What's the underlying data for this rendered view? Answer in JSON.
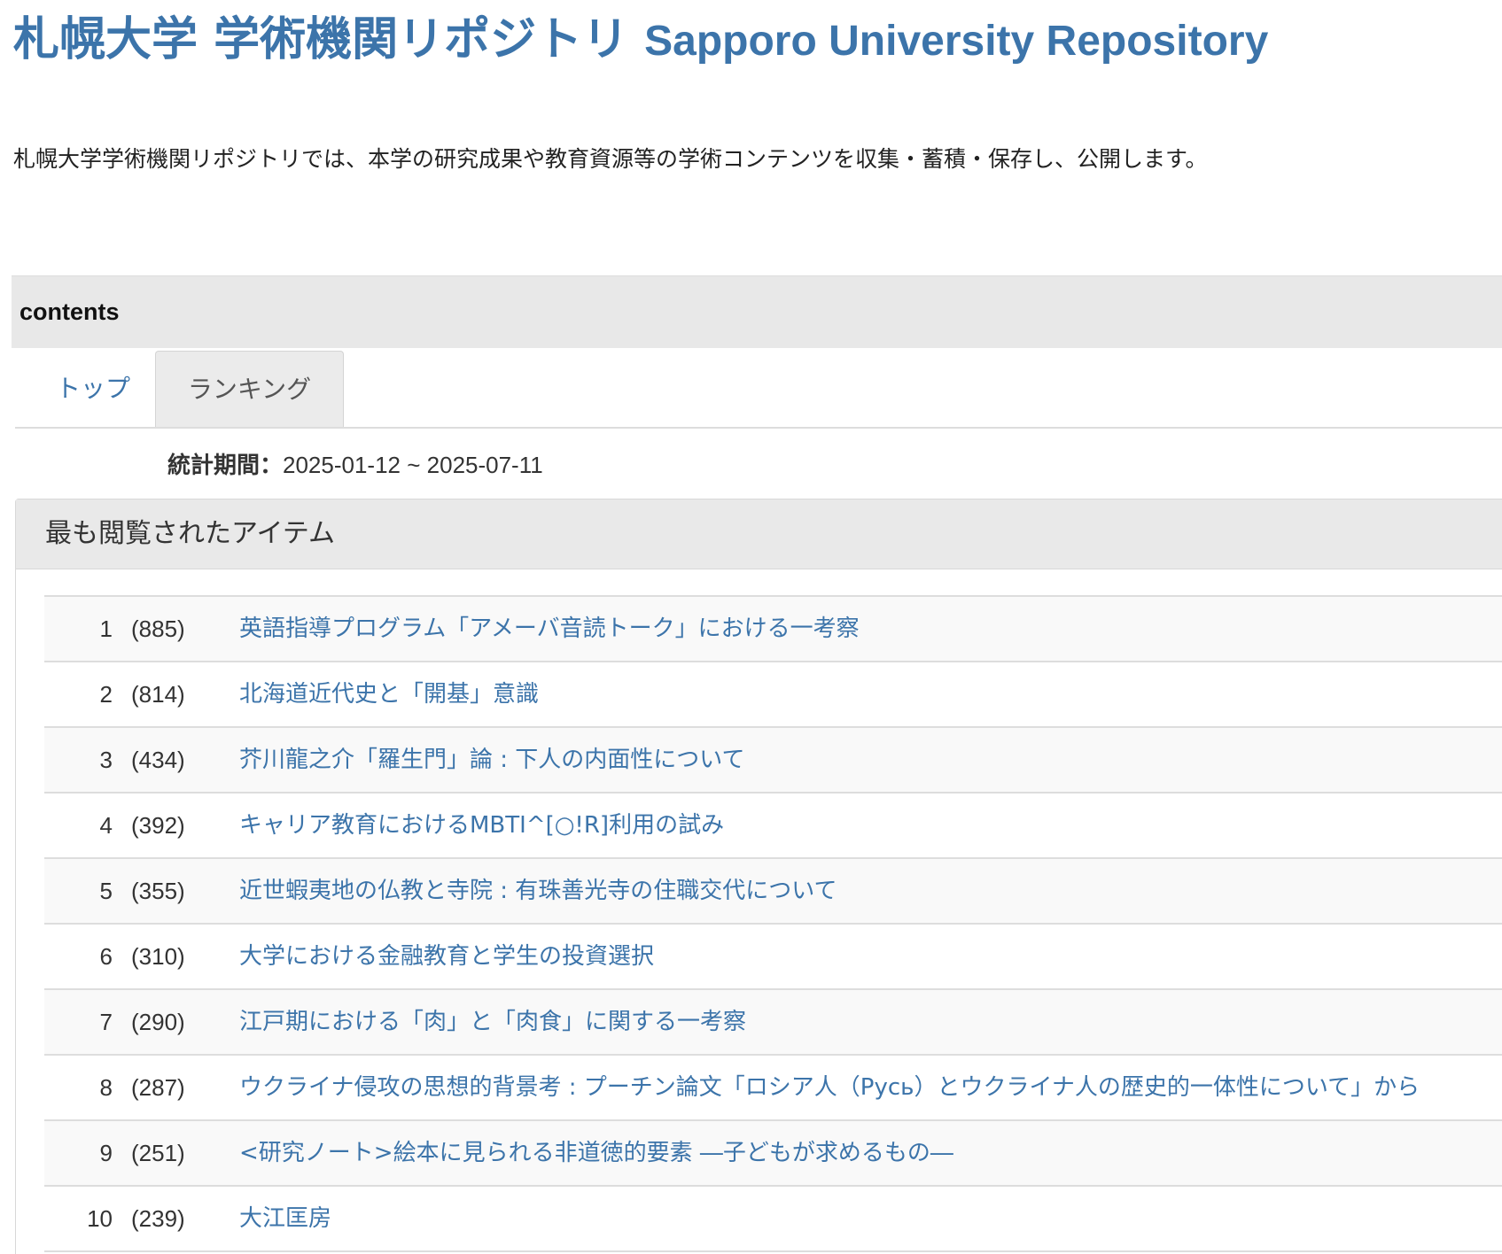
{
  "header": {
    "title_jp": "札幌大学 学術機関リポジトリ",
    "title_en": "Sapporo University Repository",
    "intro": "札幌大学学術機関リポジトリでは、本学の研究成果や教育資源等の学術コンテンツを収集・蓄積・保存し、公開します。"
  },
  "contents": {
    "label": "contents"
  },
  "tabs": [
    {
      "label": "トップ",
      "active": false
    },
    {
      "label": "ランキング",
      "active": true
    }
  ],
  "period": {
    "label": "統計期間：",
    "value": "2025-01-12 ~ 2025-07-11"
  },
  "ranking": {
    "heading": "最も閲覧されたアイテム",
    "items": [
      {
        "rank": "1",
        "count": "(885)",
        "title": "英語指導プログラム「アメーバ音読トーク」における一考察"
      },
      {
        "rank": "2",
        "count": "(814)",
        "title": "北海道近代史と「開基」意識"
      },
      {
        "rank": "3",
        "count": "(434)",
        "title": "芥川龍之介「羅生門」論 : 下人の内面性について"
      },
      {
        "rank": "4",
        "count": "(392)",
        "title": "キャリア教育におけるMBTI^[○!R]利用の試み"
      },
      {
        "rank": "5",
        "count": "(355)",
        "title": "近世蝦夷地の仏教と寺院 : 有珠善光寺の住職交代について"
      },
      {
        "rank": "6",
        "count": "(310)",
        "title": "大学における金融教育と学生の投資選択"
      },
      {
        "rank": "7",
        "count": "(290)",
        "title": "江戸期における「肉」と「肉食」に関する一考察"
      },
      {
        "rank": "8",
        "count": "(287)",
        "title": "ウクライナ侵攻の思想的背景考 : プーチン論文「ロシア人（Русь）とウクライナ人の歴史的一体性について」から"
      },
      {
        "rank": "9",
        "count": "(251)",
        "title": "<研究ノート>絵本に見られる非道徳的要素 ―子どもが求めるもの―"
      },
      {
        "rank": "10",
        "count": "(239)",
        "title": "大江匡房"
      }
    ]
  },
  "colors": {
    "link": "#3c74aa",
    "bar_bg": "#e8e8e8",
    "row_alt": "#f9f9f9"
  }
}
